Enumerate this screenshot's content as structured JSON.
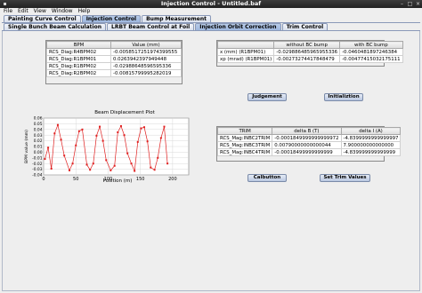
{
  "window": {
    "title": "Injection Control - Untitled.baf"
  },
  "menu": [
    "File",
    "Edit",
    "View",
    "Window",
    "Help"
  ],
  "main_tabs": [
    {
      "label": "Painting Curve Control",
      "selected": false
    },
    {
      "label": "Injection Control",
      "selected": true
    },
    {
      "label": "Bump Measurement",
      "selected": false
    }
  ],
  "sub_tabs": [
    {
      "label": "Single Bunch Beam Calculation",
      "selected": false
    },
    {
      "label": "LRBT Beam Control at Foil",
      "selected": false
    },
    {
      "label": "Injection Orbit Correction",
      "selected": true
    },
    {
      "label": "Trim Control",
      "selected": false
    }
  ],
  "bpm_table": {
    "headers": [
      "BPM",
      "Value (mm)"
    ],
    "rows": [
      [
        "RCS_Diag:R4BPM02",
        "-0.0058517251974399555"
      ],
      [
        "RCS_Diag:R1BPM01",
        "0.0263942397949448"
      ],
      [
        "RCS_Diag:R1BPM02",
        "-0.02988648596595336"
      ],
      [
        "RCS_Diag:R2BPM02",
        "-0.00815799995282019"
      ]
    ]
  },
  "bc_table": {
    "headers": [
      "",
      "without BC bump",
      "with BC bump"
    ],
    "rows": [
      [
        "x (mm)   (R1BPM01)",
        "-0.029886485965955336",
        "-0.0460481897246384"
      ],
      [
        "xp (mrad) (R1BPM01)",
        "-0.00273274417848479",
        "-0.00477415032175111"
      ]
    ]
  },
  "buttons": {
    "judgement": "Judgement",
    "initialization": "Initializtion",
    "calbutton": "Calbutton",
    "set_trim": "Set Trim Values"
  },
  "trim_table": {
    "headers": [
      "TRIM",
      "delta B (T)",
      "delta I (A)"
    ],
    "rows": [
      [
        "RCS_Mag:INBC2TRIM",
        "-0.0001849999999999972",
        "-4.8399999999999997"
      ],
      [
        "RCS_Mag:INBC3TRIM",
        "0.00790000000000044",
        "7.900000000000000"
      ],
      [
        "RCS_Mag:INBC4TRIM",
        "-0.00018499999999999",
        "-4.839999999999999"
      ]
    ]
  },
  "chart_data": {
    "type": "line",
    "title": "Beam Displacement Plot",
    "xlabel": "Position (m)",
    "ylabel": "BPM value (mm)",
    "xlim": [
      0,
      225
    ],
    "ylim": [
      -0.04,
      0.06
    ],
    "xticks": [
      0,
      50,
      100,
      150,
      200
    ],
    "yticks": [
      -0.04,
      -0.03,
      -0.02,
      -0.01,
      0.0,
      0.01,
      0.02,
      0.03,
      0.04,
      0.05,
      0.06
    ],
    "grid": true,
    "color": "#e02020",
    "x": [
      2,
      7,
      12,
      17,
      22,
      27,
      32,
      40,
      45,
      50,
      55,
      60,
      67,
      72,
      77,
      82,
      87,
      92,
      97,
      104,
      110,
      115,
      120,
      125,
      130,
      136,
      141,
      146,
      151,
      156,
      161,
      166,
      172,
      177,
      182,
      187,
      192
    ],
    "y": [
      -0.012,
      0.008,
      -0.029,
      0.033,
      0.048,
      0.022,
      -0.006,
      -0.032,
      -0.02,
      0.012,
      0.037,
      0.04,
      -0.022,
      -0.031,
      -0.02,
      0.029,
      0.045,
      0.02,
      -0.014,
      -0.032,
      -0.024,
      0.035,
      0.046,
      0.03,
      -0.002,
      -0.02,
      -0.033,
      0.018,
      0.042,
      0.044,
      0.019,
      -0.027,
      -0.031,
      -0.01,
      0.025,
      0.045,
      -0.02
    ]
  }
}
